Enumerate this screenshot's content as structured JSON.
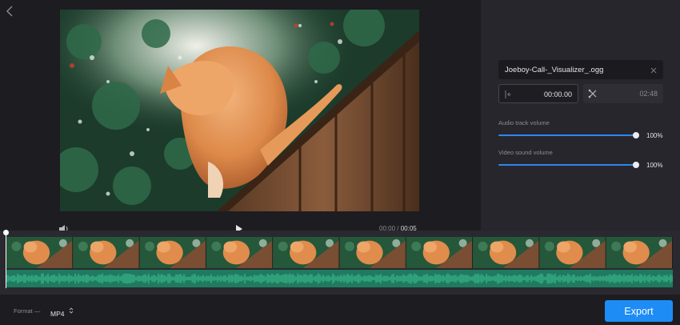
{
  "player": {
    "current_time": "00:00",
    "separator": "/",
    "total_time": "00:05"
  },
  "audio": {
    "file_name": "Joeboy-Call-_Visualizer_.ogg",
    "start_time": "00:00.00",
    "end_time": "02:48"
  },
  "volumes": {
    "audio_track_label": "Audio track volume",
    "audio_track_value": "100%",
    "audio_track_level": 1.0,
    "video_sound_label": "Video sound volume",
    "video_sound_value": "100%",
    "video_sound_level": 1.0
  },
  "timeline": {
    "frame_count": 10,
    "progress": 0.0
  },
  "format": {
    "label": "Format —",
    "selected": "MP4"
  },
  "export": {
    "label": "Export"
  },
  "icons": {
    "back": "chevron-left-icon",
    "volume": "speaker-icon",
    "play": "play-icon",
    "remove_file": "close-icon",
    "start_marker": "trim-start-icon",
    "end_marker": "scissors-icon",
    "select_caret": "updown-caret-icon"
  },
  "colors": {
    "accent": "#1d8cf5",
    "slider_fill": "#2e86f0",
    "audio_wave": "#1f7a60",
    "panel": "#27262c",
    "background": "#1d1c21"
  }
}
